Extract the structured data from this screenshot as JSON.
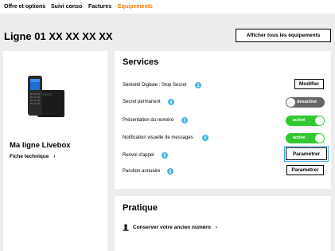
{
  "nav": {
    "items": [
      {
        "label": "Offre et options",
        "active": false
      },
      {
        "label": "Suivi conso",
        "active": false
      },
      {
        "label": "Factures",
        "active": false
      },
      {
        "label": "Equipements",
        "active": true
      }
    ],
    "accent_color": "#ff7900"
  },
  "header": {
    "title": "Ligne 01 XX XX XX XX",
    "show_all_button": "Afficher tous les équipements"
  },
  "device": {
    "name": "Ma ligne Livebox",
    "fiche_link": "Fiche technique",
    "fiche_chevron": "›",
    "icon": "cordless-phone-icon"
  },
  "services": {
    "title": "Services",
    "rows": [
      {
        "label": "Sérénité Digitale : Stop Secret",
        "control": "button",
        "button_label": "Modifier"
      },
      {
        "label": "Secret permanent",
        "control": "toggle",
        "state": "off",
        "toggle_label": "désactivé"
      },
      {
        "label": "Présentation du numéro",
        "control": "toggle",
        "state": "on",
        "toggle_label": "activé"
      },
      {
        "label": "Notification visuelle de messages",
        "control": "toggle",
        "state": "on",
        "toggle_label": "activé"
      },
      {
        "label": "Renvoi d'appel",
        "control": "button",
        "button_label": "Paramétrer"
      },
      {
        "label": "Parution annuaire",
        "control": "button",
        "button_label": "Paramétrer"
      }
    ],
    "info_icon": "info-icon",
    "info_glyph": "i",
    "on_color": "#32c832",
    "off_color": "#666666",
    "info_color": "#4bb4e6"
  },
  "pratique": {
    "title": "Pratique",
    "link": "Conserver votre ancien numéro",
    "link_chevron": "›",
    "icon": "person-icon"
  }
}
